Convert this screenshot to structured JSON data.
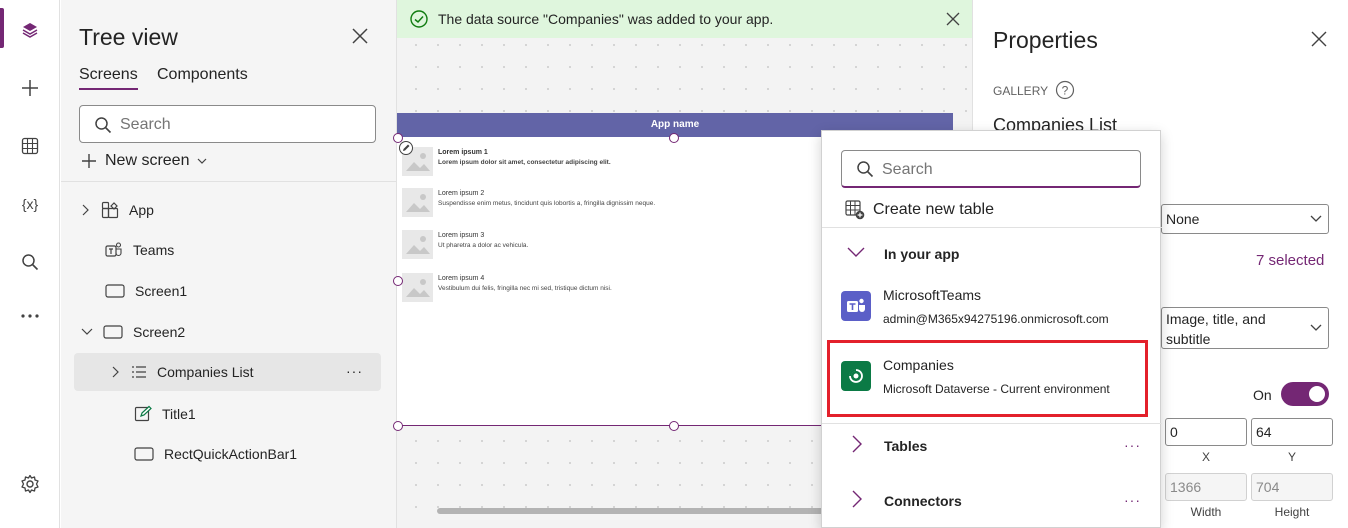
{
  "colors": {
    "accent": "#742774",
    "success_bg": "#dff6dd",
    "app_bar": "#6264a7",
    "highlight": "#e3202b"
  },
  "rail": {
    "items": [
      "layers-icon",
      "plus-icon",
      "table-icon",
      "variables-icon",
      "search-icon",
      "more-icon",
      "settings-icon"
    ],
    "variables_glyph": "{x}"
  },
  "tree": {
    "title": "Tree view",
    "tabs": [
      {
        "label": "Screens"
      },
      {
        "label": "Components"
      }
    ],
    "search_placeholder": "Search",
    "new_screen_label": "New screen",
    "nodes": [
      {
        "label": "App"
      },
      {
        "label": "Teams"
      },
      {
        "label": "Screen1"
      },
      {
        "label": "Screen2"
      },
      {
        "label": "Companies List"
      },
      {
        "label": "Title1"
      },
      {
        "label": "RectQuickActionBar1"
      }
    ],
    "more_glyph": "···"
  },
  "banner": {
    "text": "The data source \"Companies\" was added to your app."
  },
  "canvas": {
    "app_name": "App name",
    "items": [
      {
        "title": "Lorem ipsum 1",
        "subtitle": "Lorem ipsum dolor sit amet, consectetur adipiscing elit."
      },
      {
        "title": "Lorem ipsum 2",
        "subtitle": "Suspendisse enim metus, tincidunt quis lobortis a, fringilla dignissim neque."
      },
      {
        "title": "Lorem ipsum 3",
        "subtitle": "Ut pharetra a dolor ac vehicula."
      },
      {
        "title": "Lorem ipsum 4",
        "subtitle": "Vestibulum dui felis, fringilla nec mi sed, tristique dictum nisi."
      }
    ]
  },
  "properties": {
    "title": "Properties",
    "type_label": "GALLERY",
    "control_name": "Companies List",
    "data_source_value": "None",
    "fields_value": "7 selected",
    "layout_value": "Image, title, and subtitle",
    "visible_label": "On",
    "visible": true,
    "x": "0",
    "y": "64",
    "x_label": "X",
    "y_label": "Y",
    "width": "1366",
    "height": "704",
    "width_label": "Width",
    "height_label": "Height"
  },
  "flyout": {
    "search_placeholder": "Search",
    "create_label": "Create new table",
    "in_app_label": "In your app",
    "sources": [
      {
        "name": "MicrosoftTeams",
        "detail": "admin@M365x94275196.onmicrosoft.com",
        "icon": "teams-icon",
        "color": "#5b5fc7"
      },
      {
        "name": "Companies",
        "detail": "Microsoft Dataverse - Current environment",
        "icon": "dataverse-icon",
        "color": "#0b7a45"
      }
    ],
    "tables_label": "Tables",
    "connectors_label": "Connectors",
    "more_glyph": "···"
  }
}
